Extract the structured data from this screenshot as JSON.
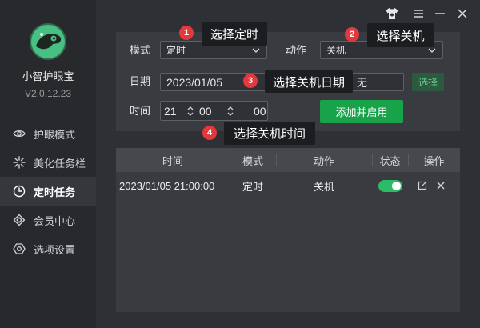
{
  "app": {
    "name": "小智护眼宝",
    "version": "V2.0.12.23",
    "logo_icon": "app-logo-icon"
  },
  "titlebar": {
    "skin_icon": "skin-icon",
    "menu_icon": "menu-icon",
    "minimize_icon": "minimize-icon",
    "close_icon": "close-icon"
  },
  "sidebar": {
    "items": [
      {
        "label": "护眼模式",
        "icon": "eye-icon",
        "active": false
      },
      {
        "label": "美化任务栏",
        "icon": "sparkle-icon",
        "active": false
      },
      {
        "label": "定时任务",
        "icon": "clock-icon",
        "active": true
      },
      {
        "label": "会员中心",
        "icon": "diamond-icon",
        "active": false
      },
      {
        "label": "选项设置",
        "icon": "settings-icon",
        "active": false
      }
    ]
  },
  "form": {
    "mode": {
      "label": "模式",
      "value": "定时"
    },
    "action": {
      "label": "动作",
      "value": "关机"
    },
    "date": {
      "label": "日期",
      "value": "2023/01/05"
    },
    "date_extra": {
      "value": "无"
    },
    "choose_button": "选择",
    "time": {
      "label": "时间",
      "hour": "21",
      "minute": "00",
      "second": "00"
    },
    "submit_button": "添加并启用"
  },
  "table": {
    "columns": [
      "时间",
      "模式",
      "动作",
      "状态",
      "操作"
    ],
    "rows": [
      {
        "time": "2023/01/05 21:00:00",
        "mode": "定时",
        "action": "关机",
        "enabled": true,
        "actions": [
          "edit-icon",
          "delete-icon"
        ]
      }
    ]
  },
  "annotations": [
    {
      "number": "1",
      "text": "选择定时"
    },
    {
      "number": "2",
      "text": "选择关机"
    },
    {
      "number": "3",
      "text": "选择关机日期"
    },
    {
      "number": "4",
      "text": "选择关机时间"
    }
  ],
  "colors": {
    "window_bg": "#2e3035",
    "sidebar_bg": "#27292d",
    "panel_bg": "#393b40",
    "header_bg": "#46484d",
    "input_bg": "#2f3136",
    "input_border": "#5d5f64",
    "active_item_bg": "#35373c",
    "accent_green": "#18a34b",
    "toggle_on": "#2cbc69",
    "choose_bg": "#2c5a3e",
    "choose_text": "#6cc892",
    "annotation_red": "#e5383b",
    "annotation_bg": "#1c1d20"
  }
}
